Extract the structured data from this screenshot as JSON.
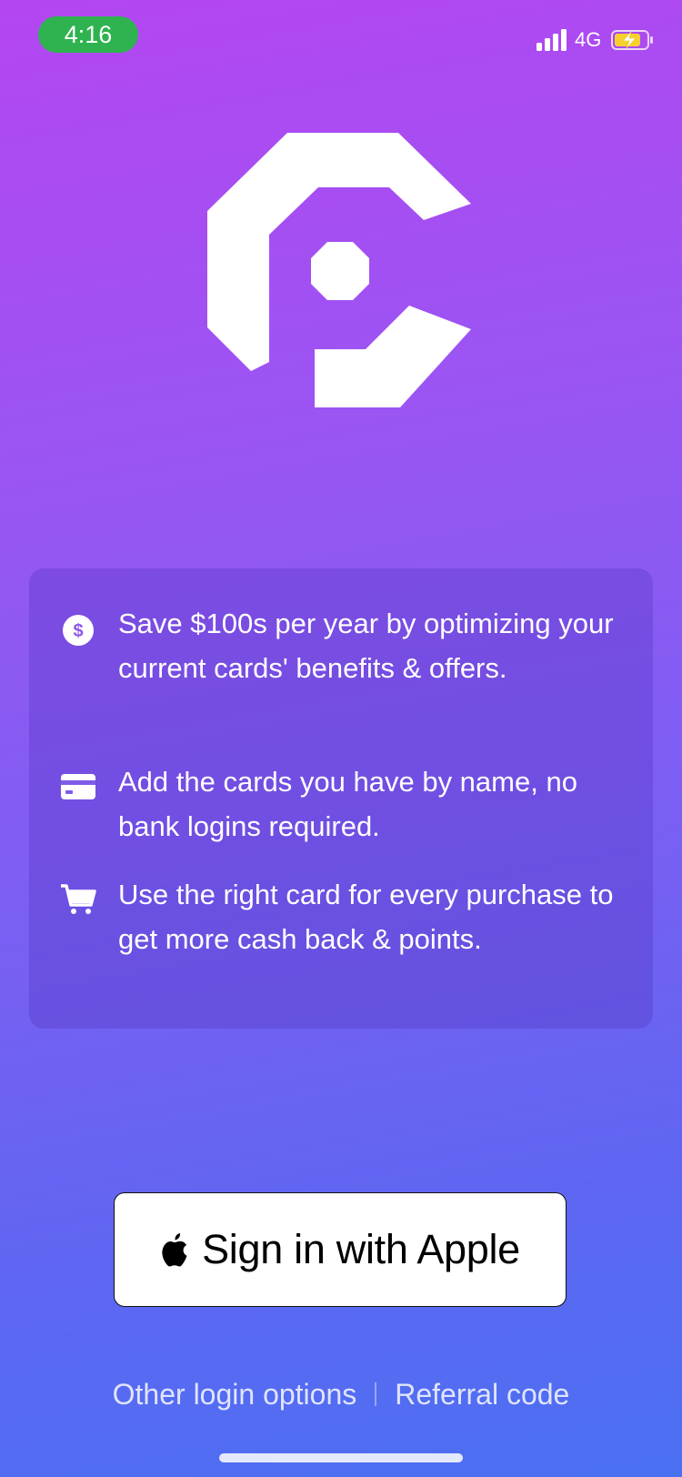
{
  "status_bar": {
    "time": "4:16",
    "network": "4G",
    "icons": [
      "signal-icon",
      "battery-charging-icon"
    ]
  },
  "logo": {
    "icon": "cardpointers-logo-icon"
  },
  "features": [
    {
      "icon": "dollar-circle-icon",
      "text": "Save $100s per year by optimizing your current cards' benefits & offers."
    },
    {
      "icon": "credit-card-icon",
      "text": "Add the cards you have by name, no bank logins required."
    },
    {
      "icon": "shopping-cart-icon",
      "text": "Use the right card for every purchase to get more cash back & points."
    }
  ],
  "sign_in": {
    "label": "Sign in with Apple",
    "icon": "apple-logo-icon"
  },
  "footer": {
    "other_login": "Other login options",
    "referral": "Referral code"
  },
  "colors": {
    "background_top": "#b446f2",
    "background_bottom": "#4a70f2",
    "time_pill": "#2fb350",
    "battery_charging": "#f5d130"
  }
}
